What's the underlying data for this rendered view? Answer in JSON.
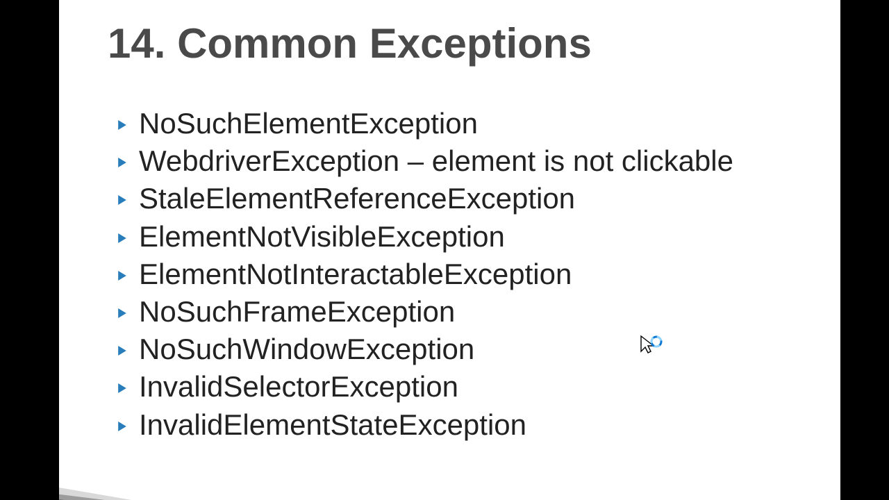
{
  "slide": {
    "title": "14. Common Exceptions",
    "bullets": [
      "NoSuchElementException",
      "WebdriverException – element is not clickable",
      "StaleElementReferenceException",
      "ElementNotVisibleException",
      "ElementNotInteractableException",
      "NoSuchFrameException",
      "NoSuchWindowException",
      "InvalidSelectorException",
      "InvalidElementStateException"
    ]
  }
}
